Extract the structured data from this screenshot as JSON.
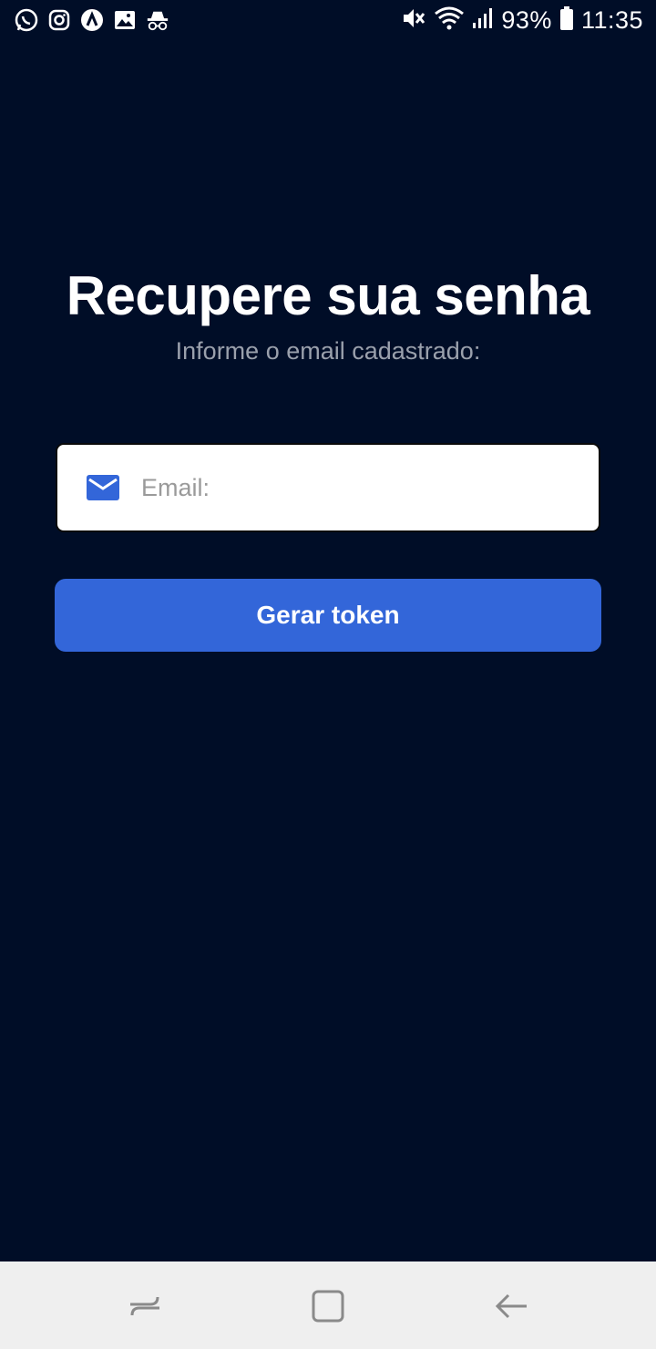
{
  "status_bar": {
    "left_icons": [
      "whatsapp-icon",
      "instagram-icon",
      "app-a-icon",
      "image-icon",
      "incognito-icon"
    ],
    "right_icons": [
      "mute-icon",
      "wifi-icon",
      "signal-icon",
      "battery-icon"
    ],
    "battery": "93%",
    "time": "11:35"
  },
  "screen": {
    "title": "Recupere sua senha",
    "subtitle": "Informe o email cadastrado:",
    "email_placeholder": "Email:",
    "email_value": "",
    "submit_label": "Gerar token"
  },
  "nav_bar": {
    "buttons": [
      "recents-icon",
      "home-icon",
      "back-icon"
    ]
  },
  "colors": {
    "background": "#000d27",
    "accent": "#3366d9",
    "subtitle": "#9aa0ac",
    "nav_bar": "#efefef"
  }
}
